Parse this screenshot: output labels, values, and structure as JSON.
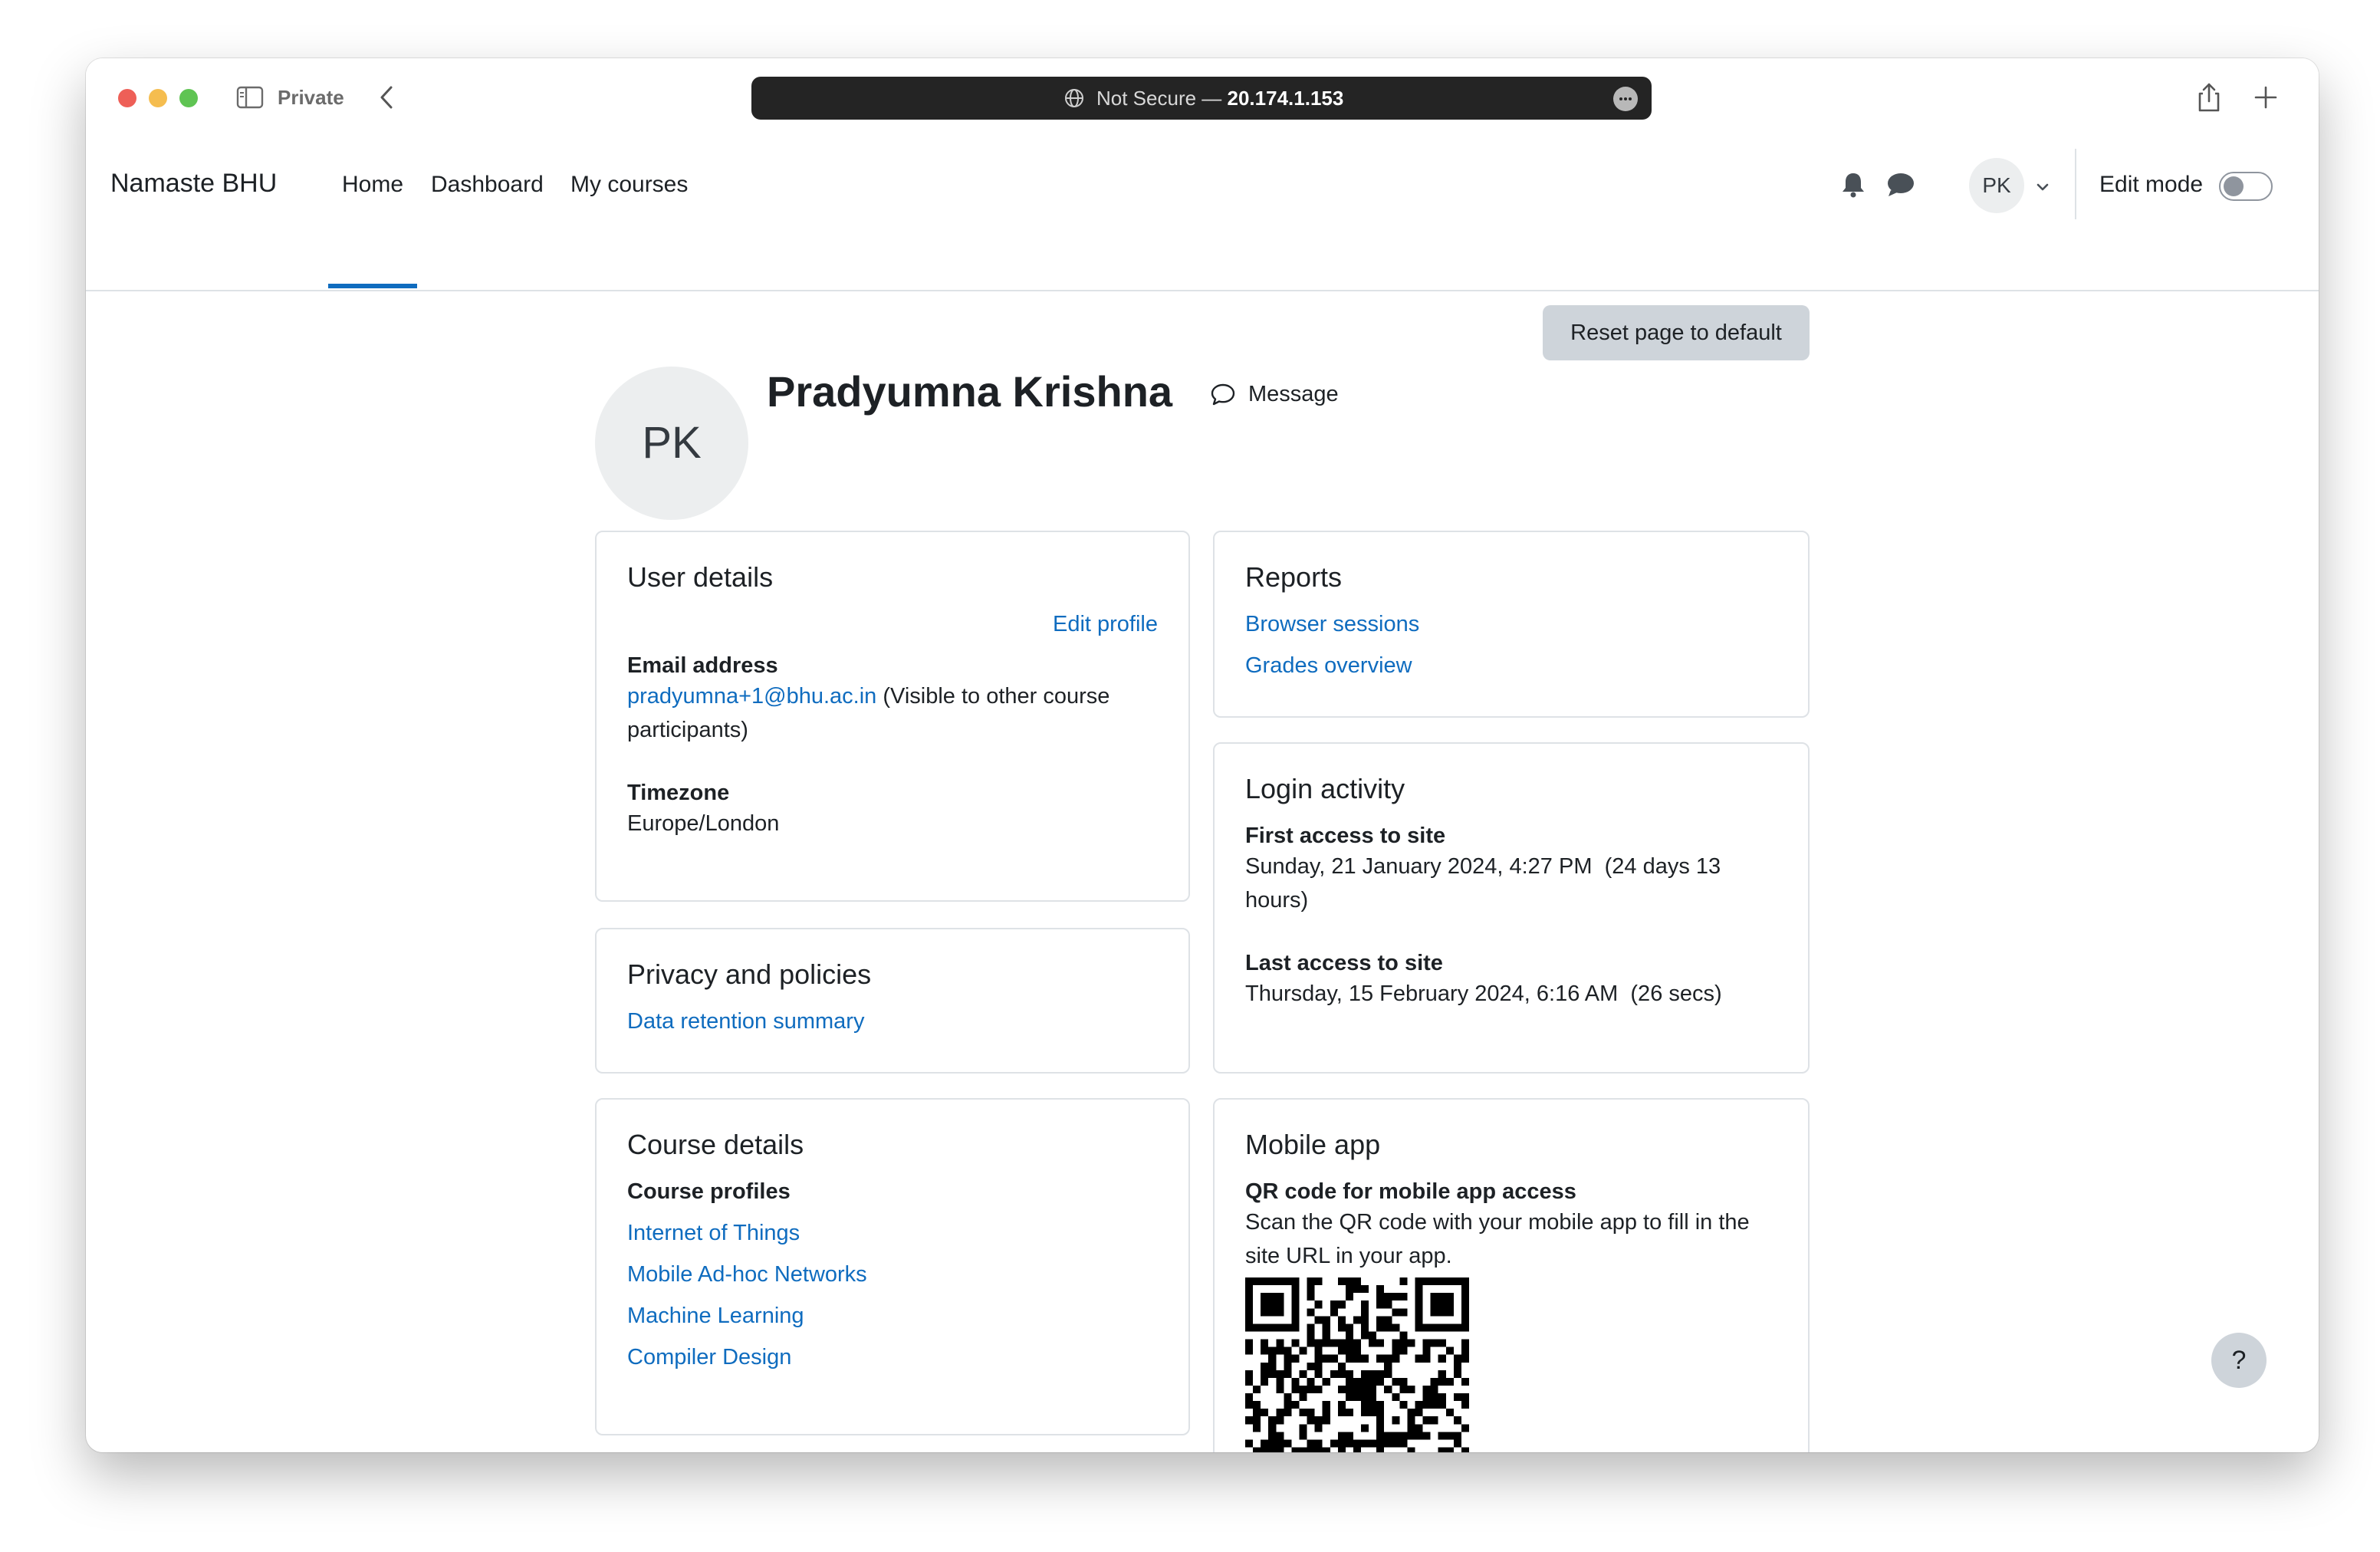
{
  "browser": {
    "private_label": "Private",
    "url_prefix": "Not Secure — ",
    "url_host": "20.174.1.153"
  },
  "navbar": {
    "brand": "Namaste BHU",
    "links": [
      {
        "label": "Home",
        "active": true
      },
      {
        "label": "Dashboard",
        "active": false
      },
      {
        "label": "My courses",
        "active": false
      }
    ],
    "user_initials": "PK",
    "edit_mode_label": "Edit mode",
    "edit_mode_on": false,
    "icons": [
      "bell-icon",
      "chat-icon",
      "chevron-down-icon"
    ]
  },
  "page": {
    "reset_button": "Reset page to default",
    "avatar_initials": "PK",
    "full_name": "Pradyumna Krishna",
    "message_label": "Message",
    "help_label": "?"
  },
  "user_details": {
    "title": "User details",
    "edit_profile": "Edit profile",
    "email_heading": "Email address",
    "email": "pradyumna+1@bhu.ac.in",
    "email_note": " (Visible to other course participants)",
    "timezone_heading": "Timezone",
    "timezone": "Europe/London"
  },
  "privacy": {
    "title": "Privacy and policies",
    "link": "Data retention summary"
  },
  "course_details": {
    "title": "Course details",
    "heading": "Course profiles",
    "courses": [
      "Internet of Things",
      "Mobile Ad-hoc Networks",
      "Machine Learning",
      "Compiler Design"
    ]
  },
  "reports": {
    "title": "Reports",
    "links": [
      "Browser sessions",
      "Grades overview"
    ]
  },
  "login_activity": {
    "title": "Login activity",
    "first_heading": "First access to site",
    "first_value": "Sunday, 21 January 2024, 4:27 PM  (24 days 13 hours)",
    "last_heading": "Last access to site",
    "last_value": "Thursday, 15 February 2024, 6:16 AM  (26 secs)"
  },
  "mobile_app": {
    "title": "Mobile app",
    "heading": "QR code for mobile app access",
    "description": "Scan the QR code with your mobile app to fill in the site URL in your app."
  },
  "colors": {
    "accent": "#0f6cbf",
    "text": "#1d2125",
    "button_bg": "#ced4da",
    "card_border": "#dee2e6"
  }
}
